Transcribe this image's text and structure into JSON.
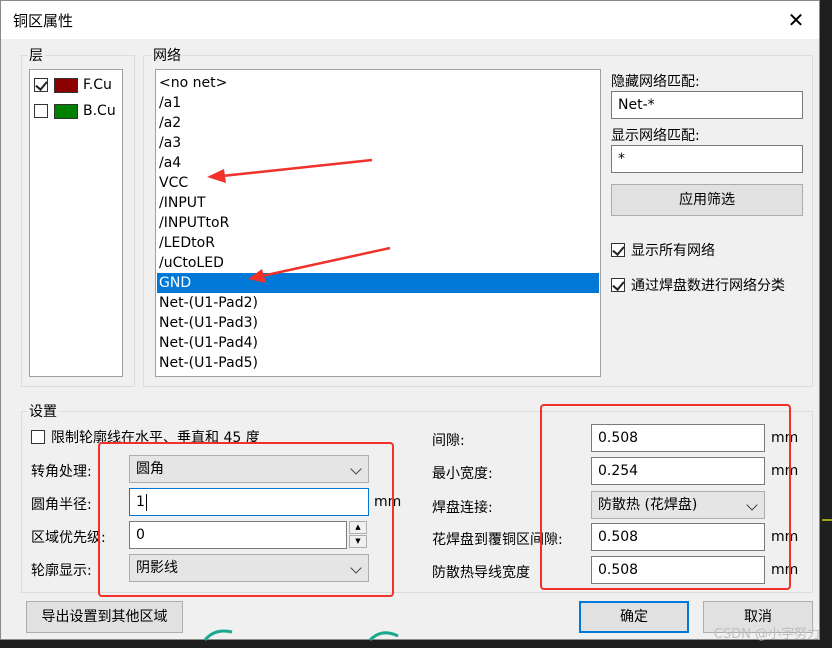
{
  "dialog": {
    "title": "铜区属性",
    "close_glyph": "✕"
  },
  "layers": {
    "legend": "层",
    "items": [
      {
        "label": "F.Cu",
        "checked": true,
        "color": "#8b0000"
      },
      {
        "label": "B.Cu",
        "checked": false,
        "color": "#008000"
      }
    ]
  },
  "nets": {
    "legend": "网络",
    "items": [
      "<no net>",
      "/a1",
      "/a2",
      "/a3",
      "/a4",
      "VCC",
      "/INPUT",
      "/INPUTtoR",
      "/LEDtoR",
      "/uCtoLED",
      "GND",
      "Net-(U1-Pad2)",
      "Net-(U1-Pad3)",
      "Net-(U1-Pad4)",
      "Net-(U1-Pad5)"
    ],
    "selected": "GND",
    "hide_label": "隐藏网络匹配:",
    "hide_value": "Net-*",
    "show_label": "显示网络匹配:",
    "show_value": "*",
    "apply_button": "应用筛选",
    "show_all_label": "显示所有网络",
    "show_all_checked": true,
    "sort_label": "通过焊盘数进行网络分类",
    "sort_checked": true
  },
  "settings": {
    "legend": "设置",
    "constrain_label": "限制轮廓线在水平、垂直和 45 度",
    "constrain_checked": false,
    "corner_label": "转角处理:",
    "corner_value": "圆角",
    "radius_label": "圆角半径:",
    "radius_value": "1",
    "radius_unit": "mm",
    "priority_label": "区域优先级:",
    "priority_value": "0",
    "outline_label": "轮廓显示:",
    "outline_value": "阴影线",
    "clearance_label": "间隙:",
    "clearance_value": "0.508",
    "clearance_unit": "mm",
    "min_width_label": "最小宽度:",
    "min_width_value": "0.254",
    "min_width_unit": "mm",
    "pad_conn_label": "焊盘连接:",
    "pad_conn_value": "防散热 (花焊盘)",
    "thermal_gap_label": "花焊盘到覆铜区间隙:",
    "thermal_gap_value": "0.508",
    "thermal_gap_unit": "mm",
    "spoke_label": "防散热导线宽度",
    "spoke_value": "0.508",
    "spoke_unit": "mm"
  },
  "footer": {
    "export_button": "导出设置到其他区域",
    "ok_button": "确定",
    "cancel_button": "取消"
  },
  "watermark": "CSDN @小宇努力",
  "colors": {
    "selection": "#0078d7",
    "annotation": "#f0322a"
  }
}
